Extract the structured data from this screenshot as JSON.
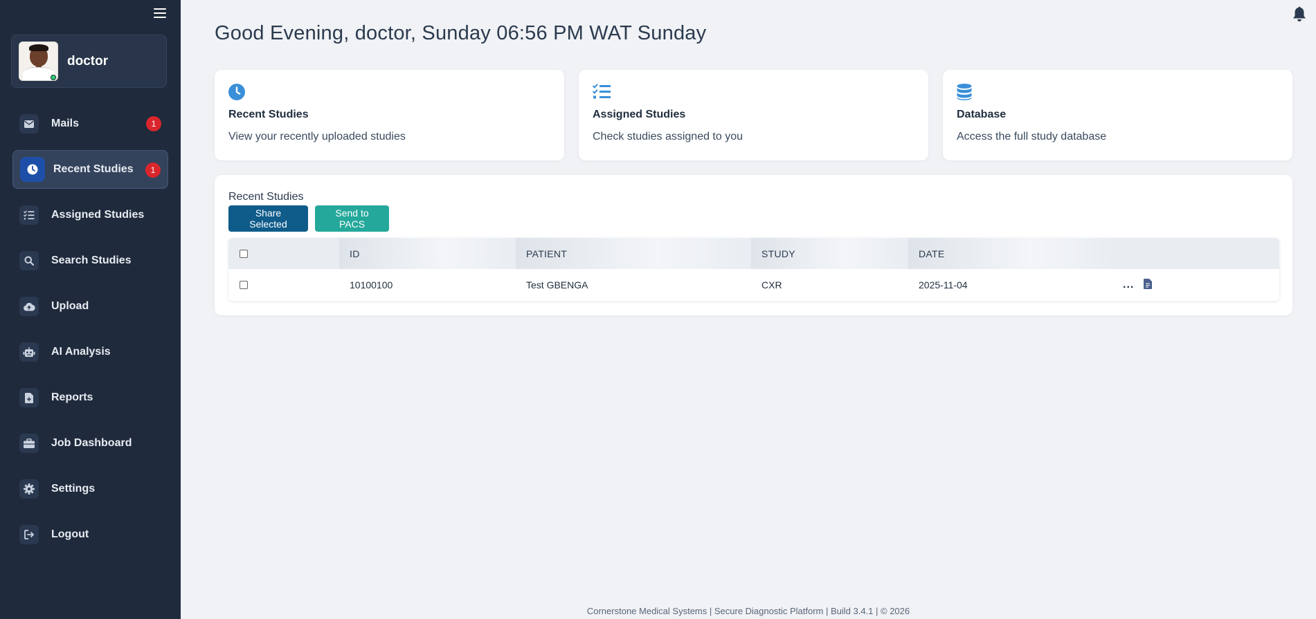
{
  "sidebar": {
    "profile_name": "doctor",
    "items": [
      {
        "label": "Mails",
        "icon": "envelope-icon",
        "badge": "1"
      },
      {
        "label": "Recent Studies",
        "icon": "clock-icon",
        "badge": "1",
        "active": true
      },
      {
        "label": "Assigned Studies",
        "icon": "checklist-icon"
      },
      {
        "label": "Search Studies",
        "icon": "search-icon"
      },
      {
        "label": "Upload",
        "icon": "cloud-upload-icon"
      },
      {
        "label": "AI Analysis",
        "icon": "robot-icon"
      },
      {
        "label": "Reports",
        "icon": "file-plus-icon"
      },
      {
        "label": "Job Dashboard",
        "icon": "briefcase-icon"
      },
      {
        "label": "Settings",
        "icon": "gear-icon"
      },
      {
        "label": "Logout",
        "icon": "logout-icon"
      }
    ]
  },
  "header": {
    "greeting": "Good Evening, doctor, Sunday 06:56 PM WAT Sunday"
  },
  "cards": [
    {
      "title": "Recent Studies",
      "desc": "View your recently uploaded studies",
      "icon": "clock-icon"
    },
    {
      "title": "Assigned Studies",
      "desc": "Check studies assigned to you",
      "icon": "checklist-icon"
    },
    {
      "title": "Database",
      "desc": "Access the full study database",
      "icon": "database-icon"
    }
  ],
  "panel": {
    "title": "Recent Studies",
    "share_label": "Share Selected",
    "pacs_label": "Send to PACS",
    "columns": [
      "",
      "ID",
      "PATIENT",
      "STUDY",
      "DATE",
      ""
    ],
    "rows": [
      {
        "id": "10100100",
        "patient": "Test GBENGA",
        "study": "CXR",
        "date": "2025-11-04",
        "more": "..."
      }
    ]
  },
  "footer": {
    "text": "Cornerstone Medical Systems | Secure Diagnostic Platform | Build 3.4.1 | © 2026"
  },
  "colors": {
    "sidebar_bg": "#1f2a3c",
    "accent_blue": "#3a8fd9",
    "share_button": "#0f5b8a",
    "pacs_button": "#24a89b",
    "badge_red": "#d9262c"
  }
}
